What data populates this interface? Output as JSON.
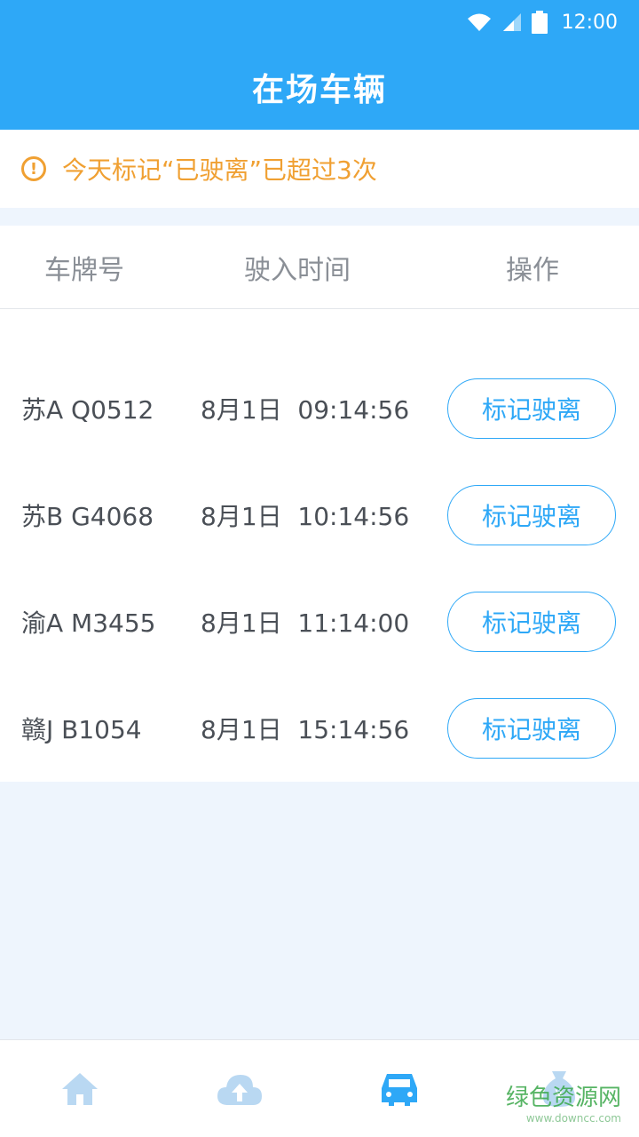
{
  "status": {
    "time": "12:00"
  },
  "header": {
    "title": "在场车辆"
  },
  "warning": {
    "text": "今天标记“已驶离”已超过3次"
  },
  "table": {
    "headers": {
      "plate": "车牌号",
      "time": "驶入时间",
      "op": "操作"
    },
    "rows": [
      {
        "plate": "苏A Q0512",
        "time": "8月1日  09:14:56",
        "button": "标记驶离"
      },
      {
        "plate": "苏B G4068",
        "time": "8月1日  10:14:56",
        "button": "标记驶离"
      },
      {
        "plate": "渝A M3455",
        "time": "8月1日  11:14:00",
        "button": "标记驶离"
      },
      {
        "plate": "赣J B1054",
        "time": "8月1日  15:14:56",
        "button": "标记驶离"
      }
    ]
  },
  "nav": {
    "items": [
      {
        "icon": "home-icon",
        "active": false
      },
      {
        "icon": "cloud-upload-icon",
        "active": false
      },
      {
        "icon": "car-icon",
        "active": true
      },
      {
        "icon": "money-bag-icon",
        "active": false
      }
    ]
  },
  "colors": {
    "primary": "#2ea8f7",
    "warning": "#f0a032",
    "inactive": "#b9d8f2"
  },
  "watermark": {
    "main": "绿色资源网",
    "sub": "www.downcc.com"
  }
}
